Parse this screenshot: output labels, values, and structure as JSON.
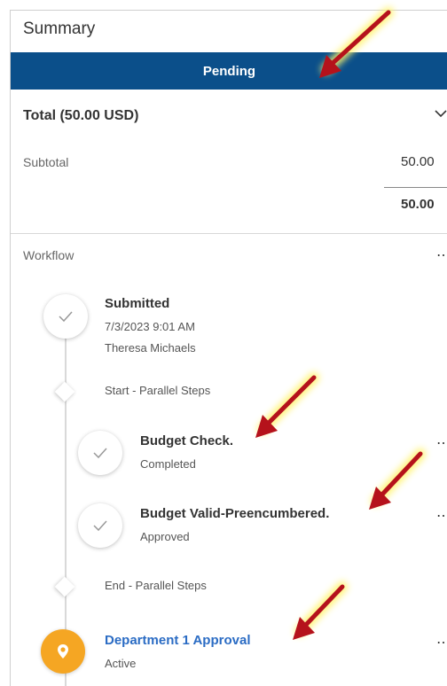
{
  "summary": {
    "title": "Summary",
    "status": "Pending",
    "total_label": "Total (50.00 USD)",
    "subtotal_label": "Subtotal",
    "subtotal_value": "50.00",
    "total_value": "50.00"
  },
  "workflow": {
    "label": "Workflow",
    "steps": [
      {
        "title": "Submitted",
        "line1": "7/3/2023 9:01 AM",
        "line2": "Theresa Michaels",
        "icon": "check-icon"
      },
      {
        "title": "Start - Parallel Steps",
        "icon": "diamond-icon"
      },
      {
        "title": "Budget Check.",
        "line1": "Completed",
        "icon": "check-icon"
      },
      {
        "title": "Budget Valid-Preencumbered.",
        "line1": "Approved",
        "icon": "check-icon"
      },
      {
        "title": "End - Parallel Steps",
        "icon": "diamond-icon"
      },
      {
        "title": "Department 1 Approval",
        "line1": "Active",
        "icon": "location-pin-icon"
      }
    ]
  },
  "colors": {
    "status_bar": "#0b4f8a",
    "active_step": "#f5a623",
    "link": "#2b6cc4",
    "annotation_arrow": "#b5121b",
    "annotation_glow": "#fff36b"
  }
}
